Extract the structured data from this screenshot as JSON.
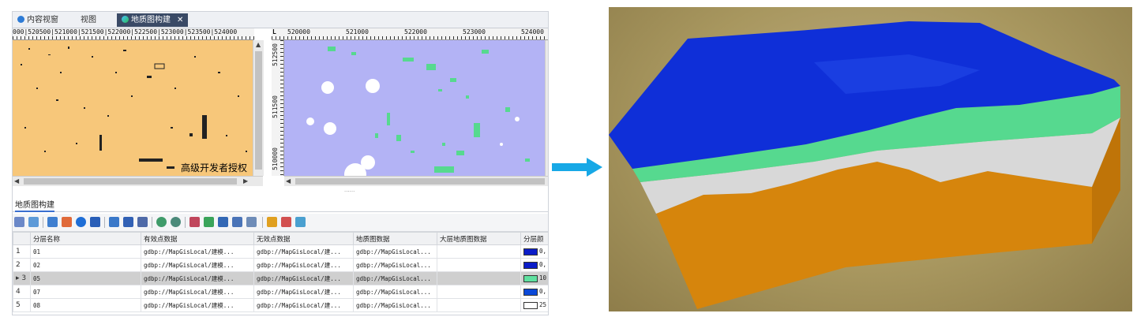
{
  "tabs": [
    {
      "label": "内容视窗",
      "icon": "globe-icon",
      "active": false
    },
    {
      "label": "视图",
      "icon": "",
      "active": false
    },
    {
      "label": "地质图构建",
      "icon": "globe-icon",
      "active": true,
      "close": "✕"
    }
  ],
  "ruler_left": {
    "text": "000|520500|521000|521500|522000|522500|523000|523500|524000"
  },
  "ruler_right": {
    "corner": "L",
    "labels": [
      "520000",
      "521000",
      "522000",
      "523000",
      "524000"
    ]
  },
  "vruler_labels": [
    "512500",
    "511500",
    "510000"
  ],
  "watermark": "高级开发者授权",
  "splitter_grip": "......",
  "panel": {
    "title": "地质图构建"
  },
  "table": {
    "headers": [
      "",
      "分层名称",
      "有效点数据",
      "无效点数据",
      "地质图数据",
      "大层地质图数据",
      "分层颜"
    ],
    "rows": [
      {
        "index": "1",
        "name": "01",
        "valid": "gdbp://MapGisLocal/建模...",
        "invalid": "gdbp://MapGisLocal/建...",
        "map": "gdbp://MapGisLocal...",
        "bigmap": "",
        "color": "#0a1cc8",
        "color_text": "0,",
        "selected": false
      },
      {
        "index": "2",
        "name": "02",
        "valid": "gdbp://MapGisLocal/建模...",
        "invalid": "gdbp://MapGisLocal/建...",
        "map": "gdbp://MapGisLocal...",
        "bigmap": "",
        "color": "#0a1cc8",
        "color_text": "0,",
        "selected": false
      },
      {
        "index": "▸ 3",
        "name": "05",
        "valid": "gdbp://MapGisLocal/建模...",
        "invalid": "gdbp://MapGisLocal/建...",
        "map": "gdbp://MapGisLocal...",
        "bigmap": "",
        "color": "#5fe0a0",
        "color_text": "10",
        "selected": true
      },
      {
        "index": "4",
        "name": "07",
        "valid": "gdbp://MapGisLocal/建模...",
        "invalid": "gdbp://MapGisLocal/建...",
        "map": "gdbp://MapGisLocal...",
        "bigmap": "",
        "color": "#0a48d8",
        "color_text": "0,",
        "selected": false
      },
      {
        "index": "5",
        "name": "08",
        "valid": "gdbp://MapGisLocal/建模...",
        "invalid": "gdbp://MapGisLocal/建...",
        "map": "gdbp://MapGisLocal...",
        "bigmap": "",
        "color": "#ffffff",
        "color_text": "25",
        "selected": false
      }
    ]
  },
  "colors": {
    "tab_active": "#3a4a66",
    "map_left_bg": "#f7c77a",
    "map_right_bg": "#b3b3f5",
    "arrow": "#17a8e6",
    "layer_top": "#0f2fd8",
    "layer_green": "#56d98f",
    "layer_grey": "#d8d8d8",
    "layer_orange": "#d6850c",
    "ground": "#a8975f"
  },
  "toolbar_icons": [
    "layer-add-icon",
    "layer-import-icon",
    "connect-icon",
    "export-icon",
    "add-circle-icon",
    "delete-icon",
    "grid-icon",
    "flag-icon",
    "table-icon",
    "refresh-icon",
    "settings-icon",
    "brush-icon",
    "fill-icon",
    "node-icon",
    "frame-icon",
    "pointer-icon",
    "edit-icon",
    "magic-icon",
    "link-icon"
  ]
}
